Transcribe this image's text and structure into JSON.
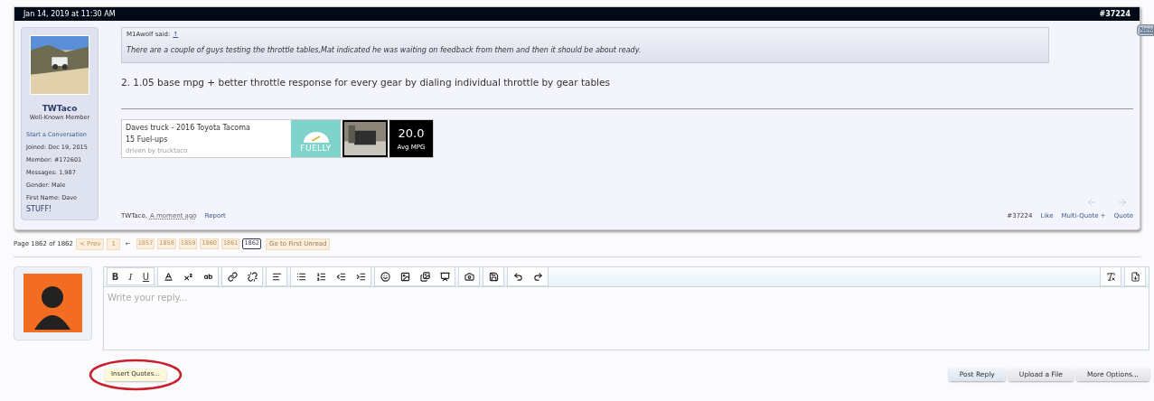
{
  "post": {
    "date": "Jan 14, 2019 at 11:30 AM",
    "number": "#37224",
    "new_tab": "New",
    "user": {
      "name": "TWTaco",
      "title": "Well-Known Member",
      "start": "Start a Conversation",
      "facts": [
        {
          "label": "Joined:",
          "value": "Dec 19, 2015"
        },
        {
          "label": "Member:",
          "value": "#172601"
        },
        {
          "label": "Messages:",
          "value": "1,987"
        },
        {
          "label": "Gender:",
          "value": "Male"
        },
        {
          "label": "First Name:",
          "value": "Dave"
        }
      ],
      "stuff": "STUFF!"
    },
    "quote": {
      "author": "M1Awolf said:",
      "link": "↑",
      "text": "There are a couple of guys testing the throttle tables,Mat indicated he was waiting on feedback from them and then it should be about ready."
    },
    "body": "2. 1.05 base mpg + better throttle response for every gear by dialing individual throttle by gear tables",
    "signature": {
      "title": "Daves truck - 2016 Toyota Tacoma",
      "fuelups": "15 Fuel-ups",
      "driver": "driven by trucktaco",
      "logo": "FUELLY",
      "mpg": "20.0",
      "mpg_label": "Avg MPG"
    },
    "footer": {
      "author": "TWTaco,",
      "time": "A moment ago",
      "report": "Report",
      "number": "#37224",
      "actions": [
        "Like",
        "Multi-Quote +",
        "Quote"
      ]
    }
  },
  "pagination": {
    "label": "Page 1862 of 1862",
    "prev": "< Prev",
    "first": "1",
    "gap": "←",
    "pages": [
      {
        "label": "1857",
        "selected": false
      },
      {
        "label": "1858",
        "selected": false
      },
      {
        "label": "1859",
        "selected": false
      },
      {
        "label": "1860",
        "selected": false
      },
      {
        "label": "1861",
        "selected": false
      },
      {
        "label": "1862",
        "selected": true
      }
    ],
    "unread": "Go to First Unread"
  },
  "editor": {
    "format_buttons": [
      "B",
      "I",
      "U"
    ],
    "placeholder": "Write your reply...",
    "insert_quotes": "Insert Quotes...",
    "buttons": [
      "Post Reply",
      "Upload a File",
      "More Options..."
    ]
  }
}
